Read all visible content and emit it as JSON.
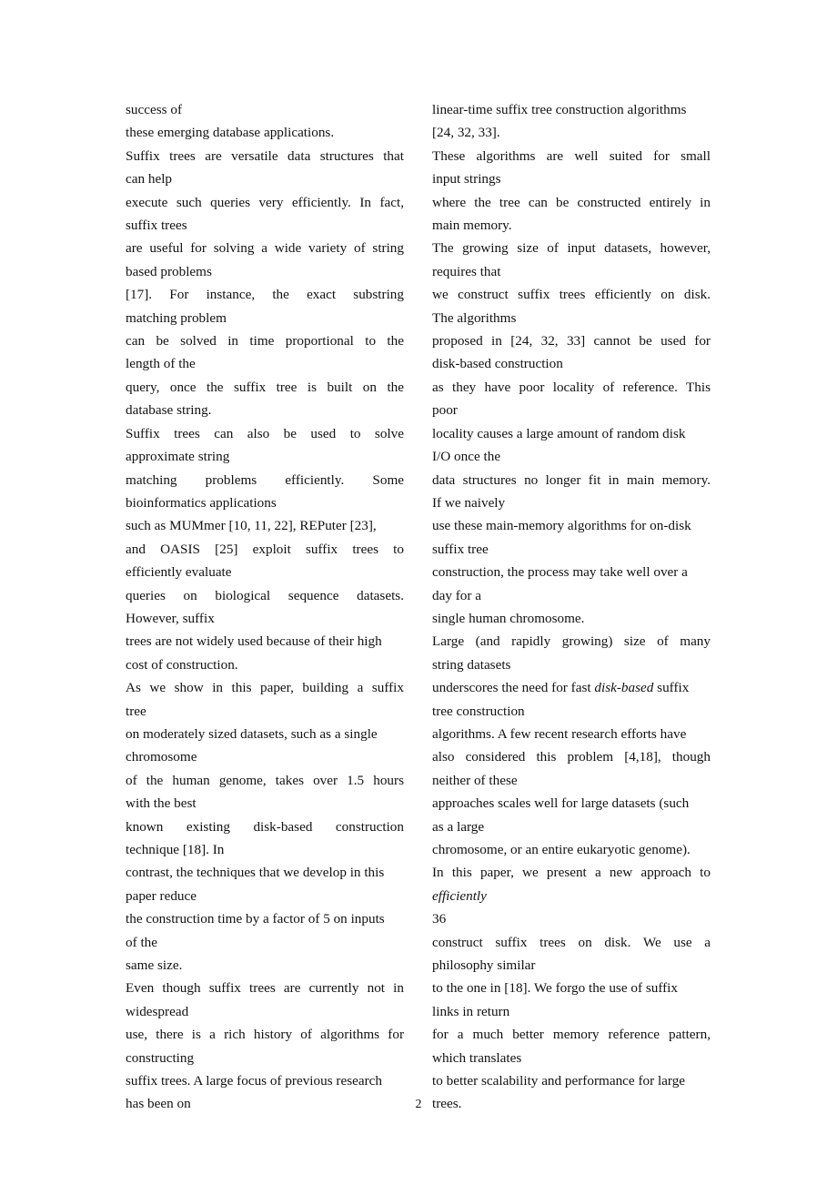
{
  "document": {
    "page_number": "2",
    "left_column": [
      {
        "text": "success of",
        "justified": false
      },
      {
        "text": "these emerging database applications.",
        "justified": false
      },
      {
        "text": "Suffix trees are versatile data structures that",
        "justified": true
      },
      {
        "text": "can help",
        "justified": false
      },
      {
        "text": "execute such queries very efficiently. In fact,",
        "justified": true
      },
      {
        "text": "suffix trees",
        "justified": false
      },
      {
        "text": "are useful for solving a wide variety of string",
        "justified": true
      },
      {
        "text": "based problems",
        "justified": false
      },
      {
        "text": "[17]. For instance, the exact substring",
        "justified": true
      },
      {
        "text": "matching problem",
        "justified": false
      },
      {
        "text": "can be solved in time proportional to the",
        "justified": true
      },
      {
        "text": "length of the",
        "justified": false
      },
      {
        "text": "query, once the suffix tree is built on the",
        "justified": true
      },
      {
        "text": "database string.",
        "justified": false
      },
      {
        "text": "Suffix trees can also be used to solve",
        "justified": true
      },
      {
        "text": "approximate string",
        "justified": false
      },
      {
        "text": "matching problems efficiently. Some",
        "justified": true
      },
      {
        "text": "bioinformatics applications",
        "justified": false
      },
      {
        "text": "such as MUMmer [10, 11, 22], REPuter [23],",
        "justified": false
      },
      {
        "text": "and OASIS [25] exploit suffix trees to",
        "justified": true
      },
      {
        "text": "efficiently evaluate",
        "justified": false
      },
      {
        "text": "queries on biological sequence datasets.",
        "justified": true
      },
      {
        "text": "However, suffix",
        "justified": false
      },
      {
        "text": "trees are not widely used because of their high",
        "justified": false
      },
      {
        "text": "cost of construction.",
        "justified": false
      },
      {
        "text": "As we show in this paper, building a suffix",
        "justified": true
      },
      {
        "text": "tree",
        "justified": false
      },
      {
        "text": "on moderately sized datasets, such as a single",
        "justified": false
      },
      {
        "text": "chromosome",
        "justified": false
      },
      {
        "text": "of the human genome, takes over 1.5 hours",
        "justified": true
      },
      {
        "text": "with the best",
        "justified": false
      },
      {
        "text": "known existing disk-based construction",
        "justified": true
      },
      {
        "text": "technique [18]. In",
        "justified": false
      },
      {
        "text": "contrast, the techniques that we develop in this",
        "justified": false
      },
      {
        "text": "paper reduce",
        "justified": false
      },
      {
        "text": "the construction time by a factor of 5 on inputs",
        "justified": false
      },
      {
        "text": "of the",
        "justified": false
      },
      {
        "text": "same size.",
        "justified": false
      },
      {
        "text": "Even though suffix trees are currently not in",
        "justified": true
      },
      {
        "text": "widespread",
        "justified": false
      },
      {
        "text": "use, there is a rich history of algorithms for",
        "justified": true
      },
      {
        "text": "constructing",
        "justified": false
      },
      {
        "text": "suffix trees. A large focus of previous research",
        "justified": false
      },
      {
        "text": "has been on",
        "justified": false
      }
    ],
    "right_column": [
      {
        "text": "linear-time suffix tree construction algorithms",
        "justified": false
      },
      {
        "text": "[24, 32, 33].",
        "justified": false
      },
      {
        "text": "These algorithms are well suited for small",
        "justified": true
      },
      {
        "text": "input strings",
        "justified": false
      },
      {
        "text": "where the tree can be constructed entirely in",
        "justified": true
      },
      {
        "text": "main memory.",
        "justified": false
      },
      {
        "text": "The growing size of input datasets, however,",
        "justified": true
      },
      {
        "text": "requires that",
        "justified": false
      },
      {
        "text": "we construct suffix trees efficiently on disk.",
        "justified": true
      },
      {
        "text": "The algorithms",
        "justified": false
      },
      {
        "text": "proposed in [24, 32, 33] cannot be used for",
        "justified": true
      },
      {
        "text": "disk-based construction",
        "justified": false
      },
      {
        "text": "as they have poor locality of reference. This",
        "justified": true
      },
      {
        "text": "poor",
        "justified": false
      },
      {
        "text": "locality causes a large amount of random disk",
        "justified": false
      },
      {
        "text": "I/O once the",
        "justified": false
      },
      {
        "text": "data structures no longer fit in main memory.",
        "justified": true
      },
      {
        "text": "If we naively",
        "justified": false
      },
      {
        "text": "use these main-memory algorithms for on-disk",
        "justified": false
      },
      {
        "text": "suffix tree",
        "justified": false
      },
      {
        "text": "construction, the process may take well over a",
        "justified": false
      },
      {
        "text": "day for a",
        "justified": false
      },
      {
        "text": "single human chromosome.",
        "justified": false
      },
      {
        "text": "Large (and rapidly growing) size of many",
        "justified": true
      },
      {
        "text": "string datasets",
        "justified": false
      },
      {
        "text": "underscores the need for fast disk-based suffix",
        "justified": false,
        "italic_segment": "disk-based"
      },
      {
        "text": "tree construction",
        "justified": false
      },
      {
        "text": "algorithms. A few recent research efforts have",
        "justified": false
      },
      {
        "text": "also considered this problem [4,18], though",
        "justified": true
      },
      {
        "text": "neither of these",
        "justified": false
      },
      {
        "text": "approaches scales well for large datasets (such",
        "justified": false
      },
      {
        "text": "as a large",
        "justified": false
      },
      {
        "text": "chromosome, or an entire eukaryotic genome).",
        "justified": false
      },
      {
        "text": "In this paper, we present a new approach to",
        "justified": true
      },
      {
        "text": "efficiently",
        "justified": false,
        "italic_segment": "efficiently"
      },
      {
        "text": "36",
        "justified": false
      },
      {
        "text": "construct suffix trees on disk. We use a",
        "justified": true
      },
      {
        "text": "philosophy similar",
        "justified": false
      },
      {
        "text": "to the one in [18]. We forgo the use of suffix",
        "justified": false
      },
      {
        "text": "links in return",
        "justified": false
      },
      {
        "text": "for a much better memory reference pattern,",
        "justified": true
      },
      {
        "text": "which translates",
        "justified": false
      },
      {
        "text": "to better scalability and performance for large",
        "justified": false
      },
      {
        "text": "trees.",
        "justified": false
      }
    ]
  }
}
